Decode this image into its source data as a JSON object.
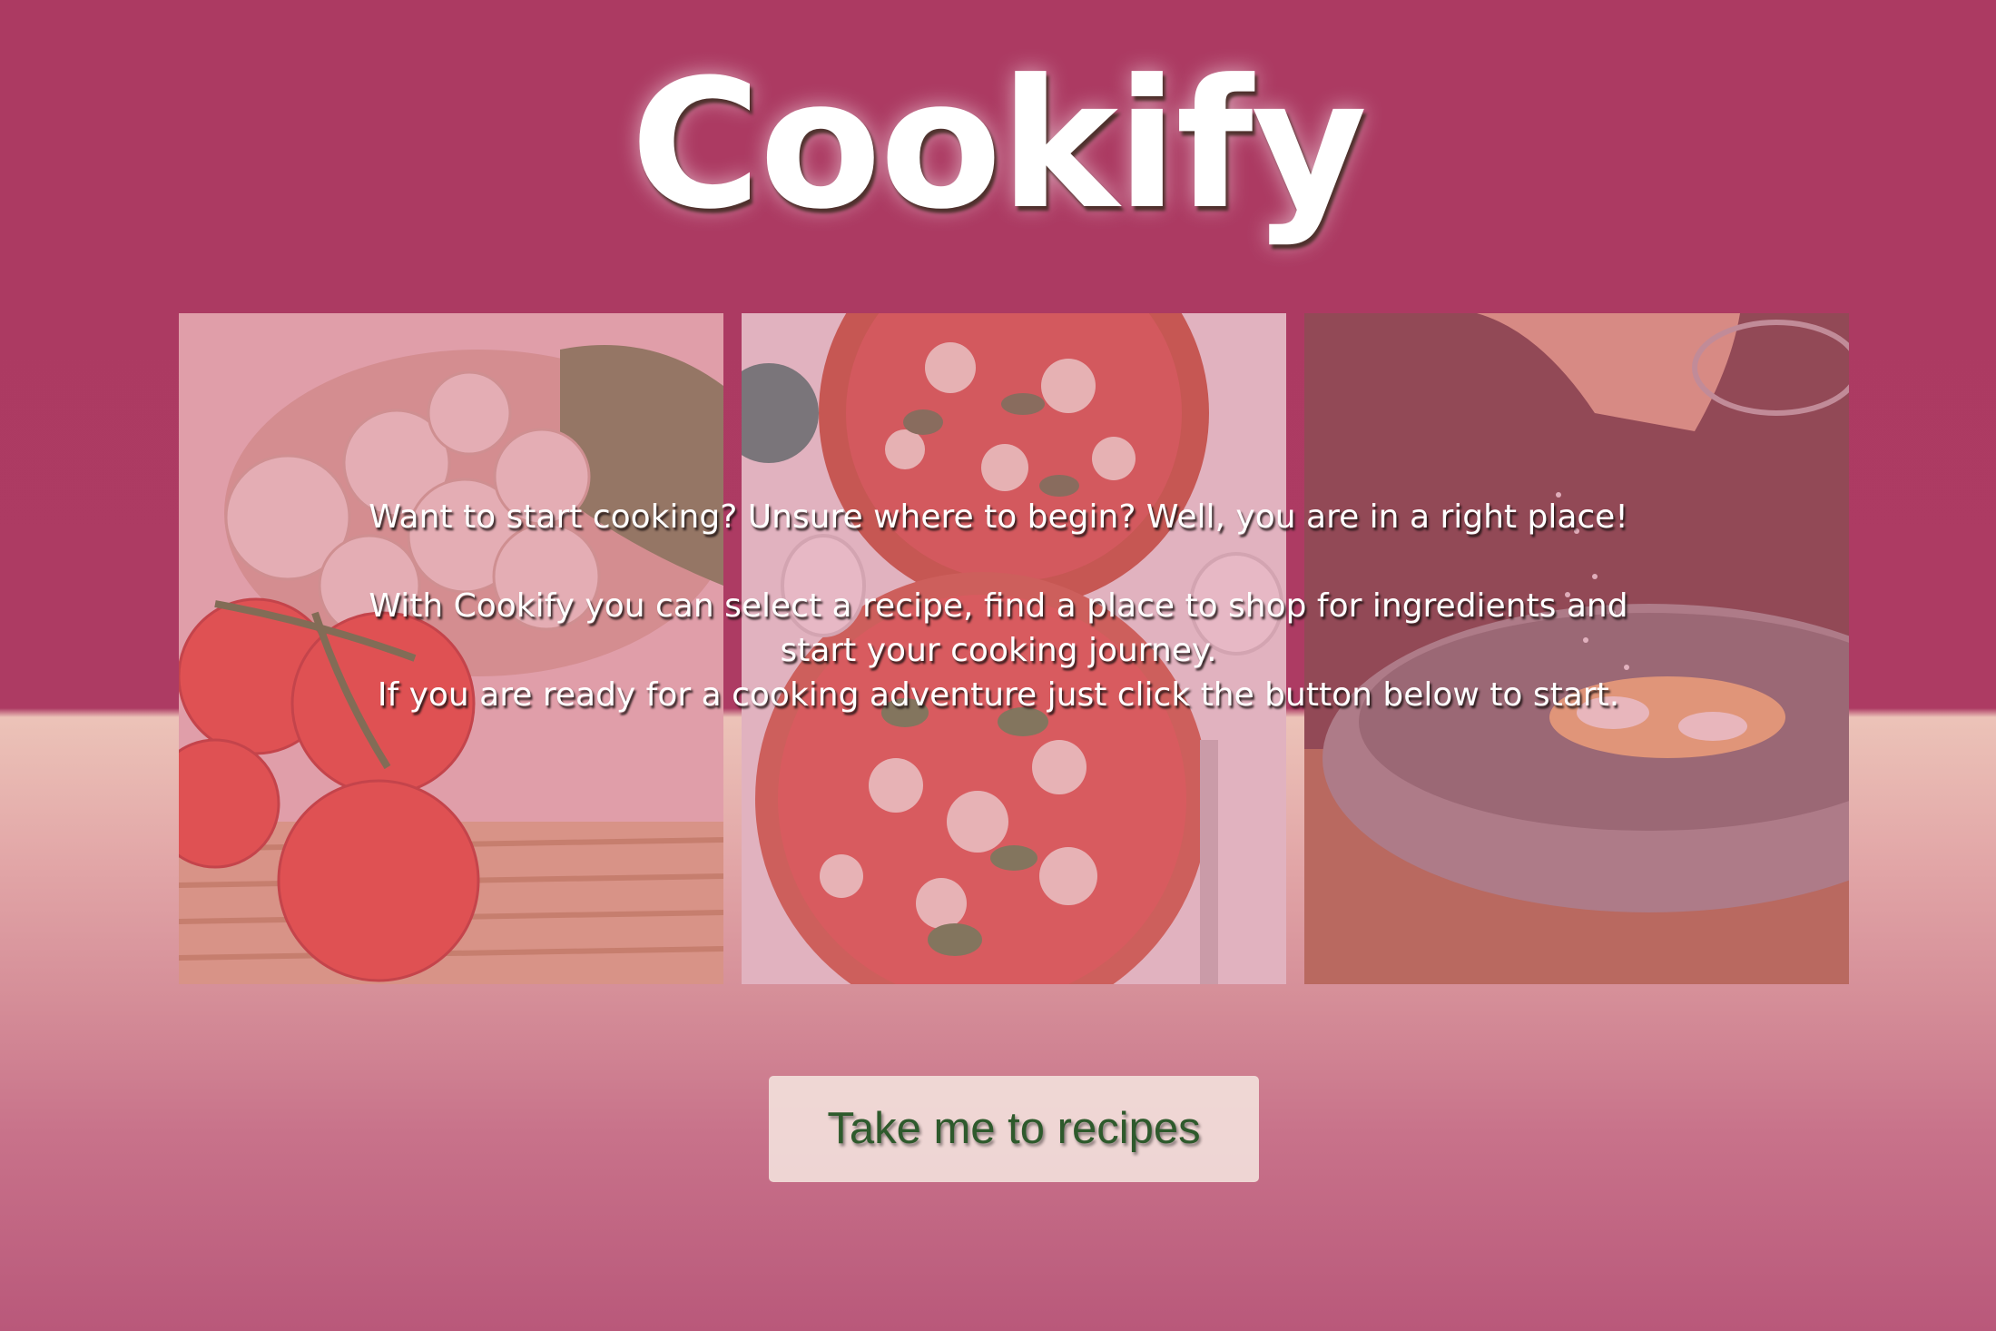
{
  "header": {
    "title": "Cookify"
  },
  "gallery": {
    "images": [
      {
        "icon": "mushrooms-tomatoes-photo"
      },
      {
        "icon": "pizza-photo"
      },
      {
        "icon": "cooking-pan-photo"
      }
    ]
  },
  "intro": {
    "line1": "Want to start cooking? Unsure where to begin? Well, you are in a right place!",
    "line2": "With Cookify you can select a recipe, find a place to shop for ingredients and start your cooking journey.",
    "line3": "If you are ready for a cooking adventure just click the button below to start."
  },
  "cta": {
    "label": "Take me to recipes"
  },
  "colors": {
    "header_bg": "#ac3a62",
    "button_bg": "#f4e4de",
    "button_text": "#2e5a2c",
    "image_tint": "#d66e8c"
  }
}
